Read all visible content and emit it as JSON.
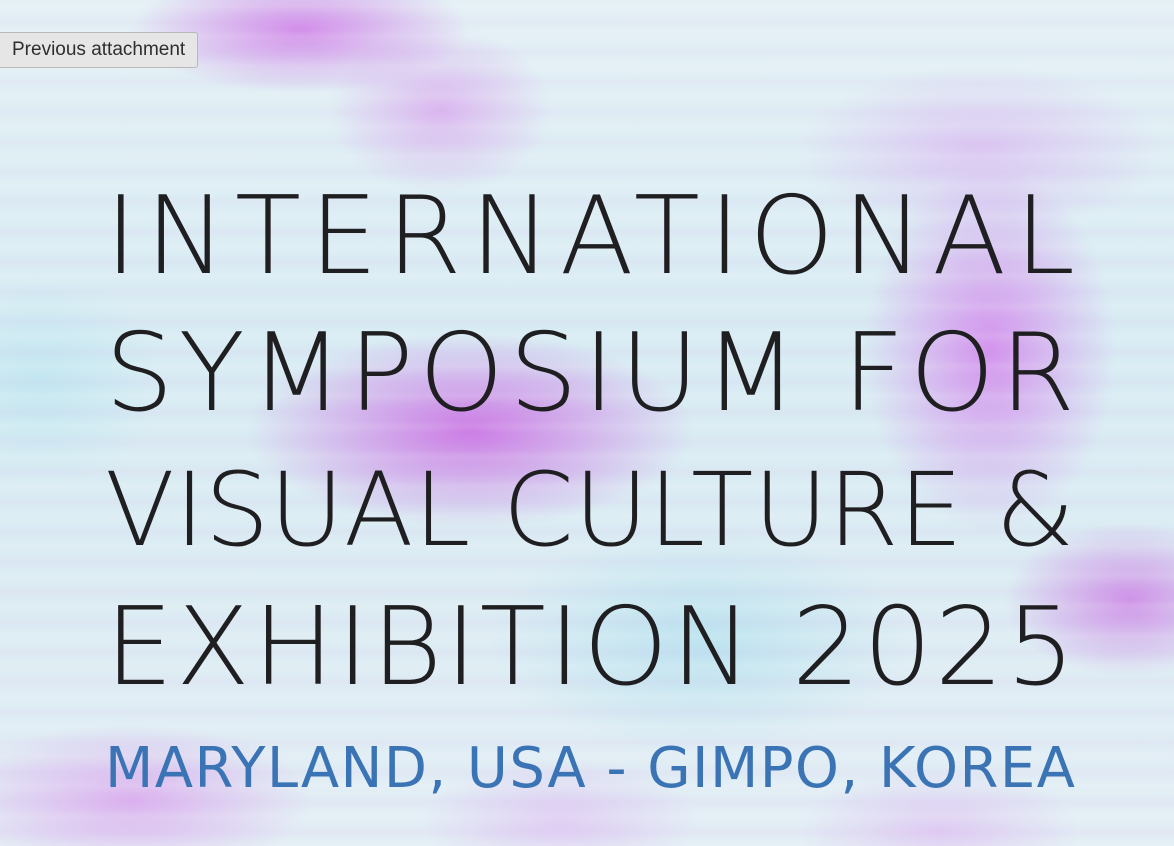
{
  "viewer": {
    "previous_attachment_label": "Previous attachment"
  },
  "poster": {
    "title_lines": [
      "INTERNATIONAL",
      "SYMPOSIUM FOR",
      "VISUAL CULTURE &",
      "EXHIBITION 2025"
    ],
    "location": "MARYLAND, USA - GIMPO, KOREA",
    "colors": {
      "title": "#1f1f22",
      "location": "#3b74b5",
      "background_accent": "#c86ee6",
      "background_base": "#dceef4"
    }
  }
}
